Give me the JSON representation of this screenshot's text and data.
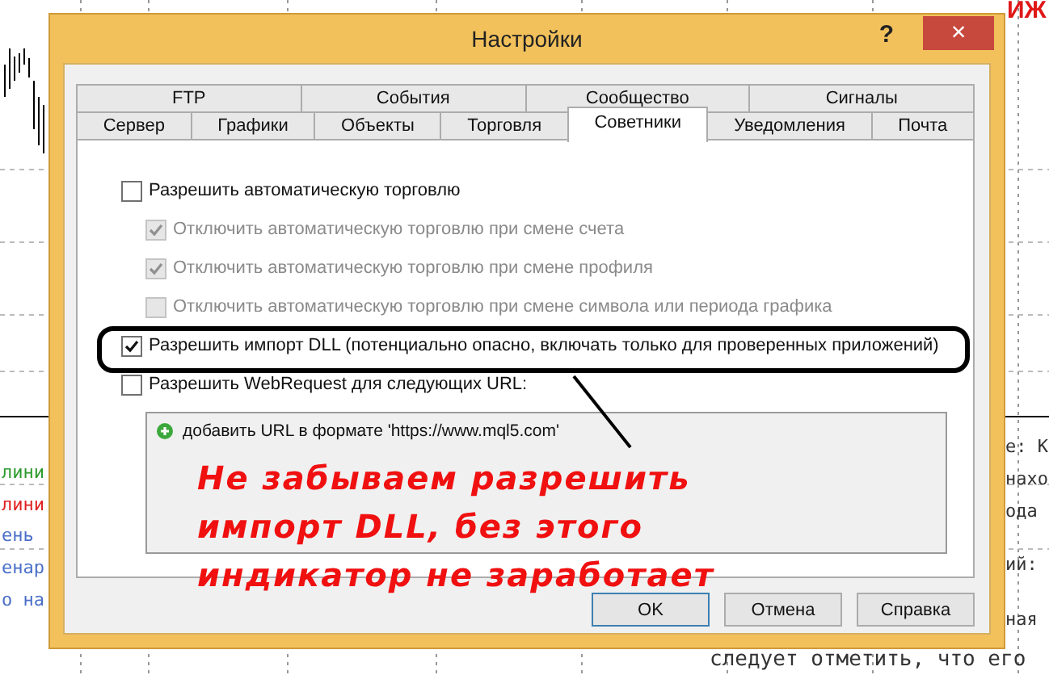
{
  "background": {
    "corner_title": "ИЖ",
    "left_texts": [
      {
        "text": "лини",
        "color": "#2e9a2e"
      },
      {
        "text": "лини",
        "color": "#e02020"
      },
      {
        "text": "ень",
        "color": "#4a6fc8"
      },
      {
        "text": "енар",
        "color": "#4a6fc8"
      },
      {
        "text": "о на",
        "color": "#4a6fc8"
      }
    ],
    "right_texts": [
      "е: К",
      "нахо",
      "ода",
      "ий:",
      "ная"
    ],
    "bottom_text": "следует отметить, что его"
  },
  "window": {
    "title": "Настройки",
    "help": "?",
    "close": "×"
  },
  "tab_rows": [
    [
      {
        "label": "FTP",
        "selected": false
      },
      {
        "label": "События",
        "selected": false
      },
      {
        "label": "Сообщество",
        "selected": false
      },
      {
        "label": "Сигналы",
        "selected": false
      }
    ],
    [
      {
        "label": "Сервер",
        "selected": false
      },
      {
        "label": "Графики",
        "selected": false
      },
      {
        "label": "Объекты",
        "selected": false
      },
      {
        "label": "Торговля",
        "selected": false
      },
      {
        "label": "Советники",
        "selected": true
      },
      {
        "label": "Уведомления",
        "selected": false
      },
      {
        "label": "Почта",
        "selected": false
      }
    ]
  ],
  "options": [
    {
      "label": "Разрешить автоматическую торговлю",
      "checked": false,
      "disabled": false,
      "children": [
        {
          "label": "Отключить автоматическую торговлю при смене счета",
          "checked": true,
          "disabled": true
        },
        {
          "label": "Отключить автоматическую торговлю при смене профиля",
          "checked": true,
          "disabled": true
        },
        {
          "label": "Отключить автоматическую торговлю при смене символа или периода графика",
          "checked": false,
          "disabled": true
        }
      ]
    },
    {
      "label": "Разрешить импорт DLL (потенциально опасно, включать только для проверенных приложений)",
      "checked": true,
      "disabled": false
    },
    {
      "label": "Разрешить WebRequest для следующих URL:",
      "checked": false,
      "disabled": false
    }
  ],
  "url_list": {
    "items": [
      "добавить URL в формате 'https://www.mql5.com'"
    ]
  },
  "buttons": [
    {
      "label": "OK",
      "default": true
    },
    {
      "label": "Отмена",
      "default": false
    },
    {
      "label": "Справка",
      "default": false
    }
  ],
  "annotation": {
    "text": "Не забываем разрешить импорт DLL, без этого индикатор не заработает"
  }
}
